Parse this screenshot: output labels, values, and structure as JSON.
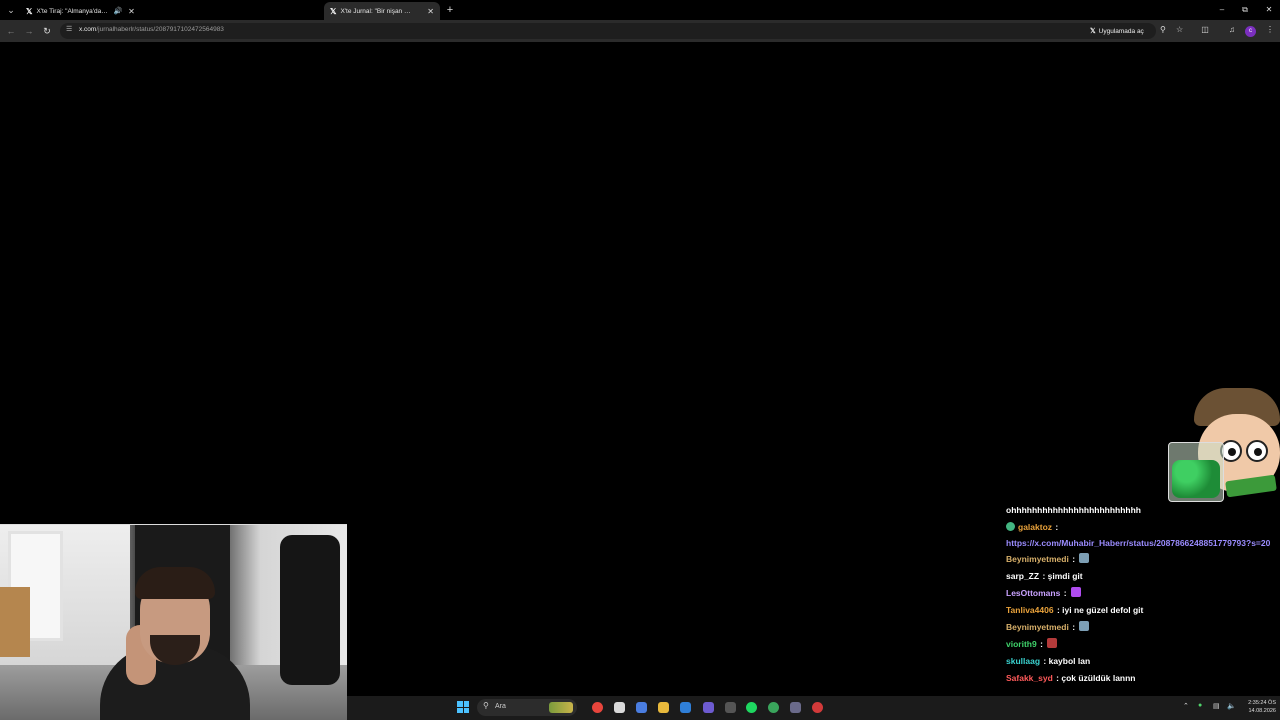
{
  "tabs": [
    {
      "title": "X'te Tiraj: \"Almanya'dan Tü",
      "audio": true
    },
    {
      "title": "X'te Jurnal: \"Bir nişan merasimi",
      "active": true
    }
  ],
  "toolbar": {
    "url_host": "x.com",
    "url_path": "/jurnalhaberlr/status/2087917102472564983",
    "open_in_app_label": "Uygulamada aç"
  },
  "chat": {
    "messages": [
      {
        "user": "",
        "color": "#ffffff",
        "text": "ohhhhhhhhhhhhhhhhhhhhhhhhh"
      },
      {
        "user": "galaktoz",
        "color": "#e9a23b",
        "badge": "#43b581",
        "text": "",
        "link": "https://x.com/Muhabir_Haberr/status/2087866248851779793?s=20"
      },
      {
        "user": "Beynimyetmedi",
        "color": "#d8b06a",
        "text": "",
        "emote": "#7d9fb5"
      },
      {
        "user": "sarp_ZZ",
        "color": "#ffffff",
        "text": "şimdi git"
      },
      {
        "user": "LesOttomans",
        "color": "#c9a2ff",
        "text": "",
        "emote": "#b04cf0"
      },
      {
        "user": "Tanliva4406",
        "color": "#e9a23b",
        "text": "iyi ne güzel defol git"
      },
      {
        "user": "Beynimyetmedi",
        "color": "#d8b06a",
        "text": "",
        "emote": "#7d9fb5"
      },
      {
        "user": "viorith9",
        "color": "#3fd36b",
        "text": "",
        "emote": "#b33a3a"
      },
      {
        "user": "skullaag",
        "color": "#3ad3d0",
        "text": "kaybol lan"
      },
      {
        "user": "Safakk_syd",
        "color": "#ff5a5a",
        "text": "çok üzüldük lannn"
      }
    ]
  },
  "taskbar": {
    "search_placeholder": "Ara",
    "clock_time": "2:35:24 ÖS",
    "clock_date": "14.08.2026"
  },
  "icons": {
    "tab_menu": "chevron-down-icon",
    "new_tab": "plus-icon",
    "back": "arrow-left-icon",
    "forward": "arrow-right-icon",
    "reload": "reload-icon",
    "zoom": "magnifier-icon",
    "bookmark": "star-icon",
    "extensions": "puzzle-icon"
  }
}
